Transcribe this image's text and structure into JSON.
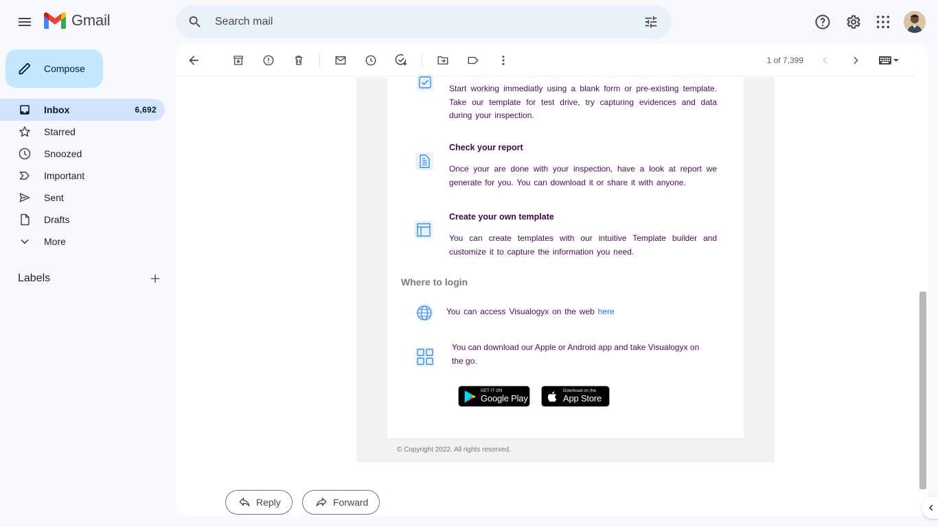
{
  "app": {
    "logo_text": "Gmail"
  },
  "search": {
    "placeholder": "Search mail"
  },
  "compose": {
    "label": "Compose"
  },
  "nav": [
    {
      "label": "Inbox",
      "count": "6,692",
      "icon": "inbox-icon"
    },
    {
      "label": "Starred",
      "count": "",
      "icon": "star-icon"
    },
    {
      "label": "Snoozed",
      "count": "",
      "icon": "clock-icon"
    },
    {
      "label": "Important",
      "count": "",
      "icon": "important-icon"
    },
    {
      "label": "Sent",
      "count": "",
      "icon": "send-icon"
    },
    {
      "label": "Drafts",
      "count": "",
      "icon": "draft-icon"
    },
    {
      "label": "More",
      "count": "",
      "icon": "chevron-down-icon"
    }
  ],
  "labels": {
    "title": "Labels"
  },
  "pager": {
    "text": "1 of 7,399"
  },
  "email": {
    "features": [
      {
        "title": "",
        "text": "Start working immediatly using a blank form or pre-existing template. Take our template for test drive, try capturing evidences and data during your inspection."
      },
      {
        "title": "Check your report",
        "text": "Once your are done with your inspection, have a look at report we generate for you. You can download it or share it with anyone."
      },
      {
        "title": "Create your own template",
        "text": "You can create templates with our intuitive Template builder and customize it to capture the information you need."
      }
    ],
    "login_title": "Where to login",
    "web_text": "You can access Visualogyx on the web",
    "web_link": "here",
    "app_text": "You can download our Apple or Android app and take Visualogyx on the go.",
    "google_play": {
      "small": "GET IT ON",
      "big": "Google Play"
    },
    "app_store": {
      "small": "Download on the",
      "big": "App Store"
    },
    "copyright": "© Copyright 2022. All rights reserved."
  },
  "actions": {
    "reply": "Reply",
    "forward": "Forward"
  },
  "colors": {
    "compose_bg": "#c2e7ff",
    "active_nav_bg": "#d3e3fd",
    "search_bg": "#eaf1fb",
    "link": "#1a73e8",
    "email_text": "#4a0a55"
  }
}
